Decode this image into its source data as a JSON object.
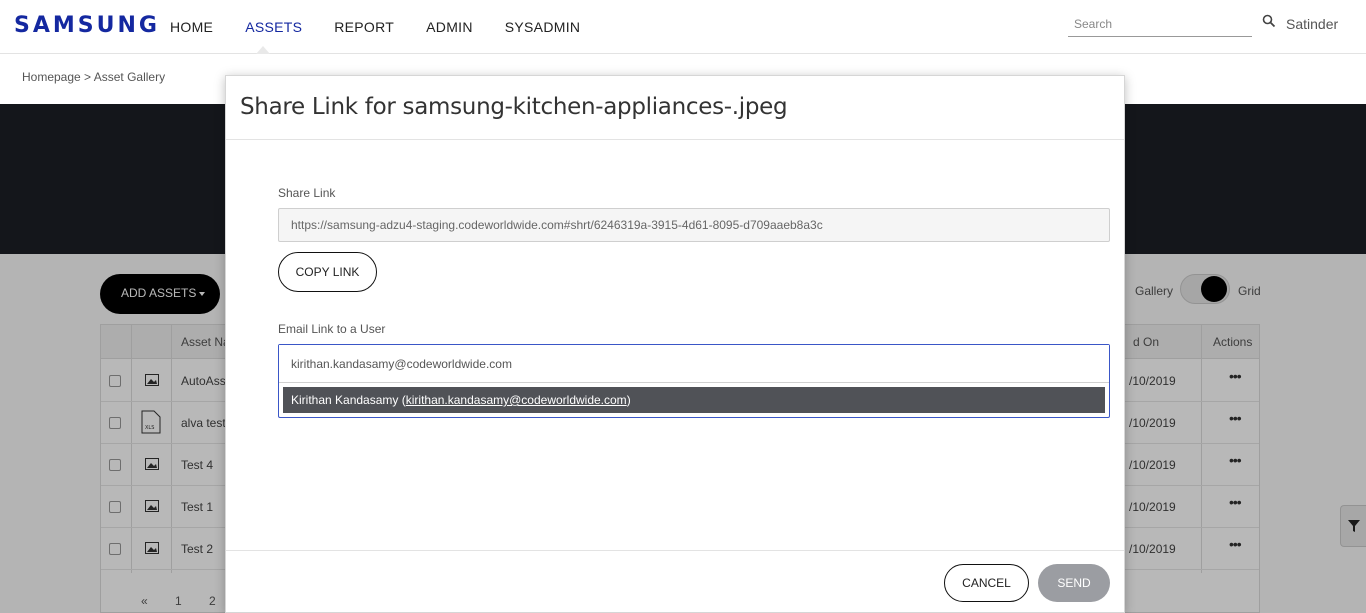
{
  "header": {
    "logo": "SAMSUNG",
    "nav": [
      "HOME",
      "ASSETS",
      "REPORT",
      "ADMIN",
      "SYSADMIN"
    ],
    "active_nav": "ASSETS",
    "search_placeholder": "Search",
    "user": "Satinder"
  },
  "breadcrumb": "Homepage > Asset Gallery",
  "toolbar": {
    "add_assets": "ADD ASSETS",
    "view_gallery": "Gallery",
    "view_grid": "Grid"
  },
  "table": {
    "col_name": "Asset Na",
    "col_date": "d On",
    "col_actions": "Actions",
    "rows": [
      {
        "name": "AutoAsse",
        "date": "/10/2019",
        "icon": "image-icon"
      },
      {
        "name": "alva test",
        "date": "/10/2019",
        "icon": "xls-file-icon"
      },
      {
        "name": "Test 4",
        "date": "/10/2019",
        "icon": "image-icon"
      },
      {
        "name": "Test 1",
        "date": "/10/2019",
        "icon": "image-icon"
      },
      {
        "name": "Test 2",
        "date": "/10/2019",
        "icon": "image-icon"
      }
    ],
    "actions_glyph": "•••",
    "pager": [
      "«",
      "1",
      "2"
    ]
  },
  "modal": {
    "title": "Share Link for samsung-kitchen-appliances-.jpeg",
    "share_link_label": "Share Link",
    "share_link_value": "https://samsung-adzu4-staging.codeworldwide.com#shrt/6246319a-3915-4d61-8095-d709aaeb8a3c",
    "copy_button": "COPY LINK",
    "email_label": "Email Link to a User",
    "email_value": "kirithan.kandasamy@codeworldwide.com",
    "suggestion_name": "Kirithan Kandasamy (",
    "suggestion_email": "kirithan.kandasamy@codeworldwide.com",
    "suggestion_close": ")",
    "cancel_button": "CANCEL",
    "send_button": "SEND"
  },
  "colors": {
    "brand": "#1428a0",
    "suggestion_bg": "#505257",
    "send_disabled": "#9b9da2"
  }
}
